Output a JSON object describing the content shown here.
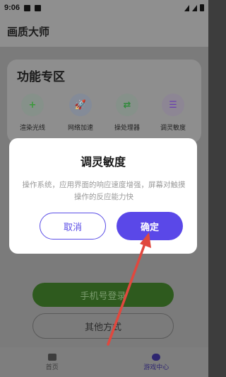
{
  "status_bar": {
    "time": "9:06"
  },
  "app_bar": {
    "title": "画质大师"
  },
  "feature_panel": {
    "title": "功能专区",
    "items": [
      {
        "label": "渲染光线",
        "icon": "plus-icon",
        "glyph": "+",
        "color": "#3a9a3a",
        "bg": "#86918a"
      },
      {
        "label": "网络加速",
        "icon": "rocket-icon",
        "glyph": "🚀",
        "color": "#3d5fb8",
        "bg": "#848b98"
      },
      {
        "label": "操处理器",
        "icon": "swap-arrows-icon",
        "glyph": "⇄",
        "color": "#2f8a3a",
        "bg": "#86918a"
      },
      {
        "label": "调灵敏度",
        "icon": "sliders-icon",
        "glyph": "☰",
        "color": "#6a3fb0",
        "bg": "#8d8694"
      }
    ]
  },
  "login": {
    "phone_label": "手机号登录",
    "other_label": "其他方式"
  },
  "tabs": [
    {
      "label": "首页",
      "icon": "home-icon"
    },
    {
      "label": "游戏中心",
      "icon": "gamepad-icon"
    }
  ],
  "dialog": {
    "title": "调灵敏度",
    "body": "操作系统，应用界面的响应速度增强，屏幕对触摸操作的反应能力快",
    "cancel_label": "取消",
    "confirm_label": "确定"
  },
  "colors": {
    "accent": "#5a48e8",
    "annotation_arrow": "#e0483e"
  }
}
